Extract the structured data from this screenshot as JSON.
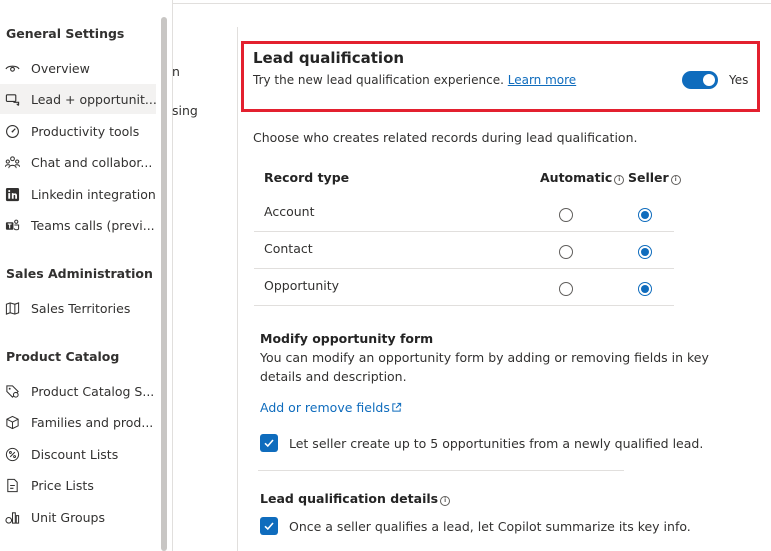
{
  "sidebar": {
    "sections": [
      {
        "title": "General Settings"
      },
      {
        "title": "Sales Administration"
      },
      {
        "title": "Product Catalog"
      }
    ],
    "items": [
      {
        "label": "Overview",
        "icon": "eye-icon"
      },
      {
        "label": "Lead + opportunit...",
        "icon": "lead-opportunity-icon",
        "selected": true
      },
      {
        "label": "Productivity tools",
        "icon": "gauge-icon"
      },
      {
        "label": "Chat and collabor...",
        "icon": "people-network-icon"
      },
      {
        "label": "Linkedin integration",
        "icon": "linkedin-icon"
      },
      {
        "label": "Teams calls (previ...",
        "icon": "teams-icon"
      },
      {
        "label": "Sales Territories",
        "icon": "map-icon"
      },
      {
        "label": "Product Catalog S...",
        "icon": "catalog-settings-icon"
      },
      {
        "label": "Families and prod...",
        "icon": "box-icon"
      },
      {
        "label": "Discount Lists",
        "icon": "percent-icon"
      },
      {
        "label": "Price Lists",
        "icon": "price-list-icon"
      },
      {
        "label": "Unit Groups",
        "icon": "unit-groups-icon"
      }
    ]
  },
  "middle": {
    "fragments": [
      "n",
      "sing"
    ]
  },
  "lead_qualification": {
    "title": "Lead qualification",
    "description": "Try the new lead qualification experience.",
    "learn_more": "Learn more",
    "toggle_label": "Yes",
    "toggle_on": true
  },
  "intro": "Choose who creates related records during lead qualification.",
  "record_table": {
    "headers": {
      "record_type": "Record type",
      "automatic": "Automatic",
      "seller": "Seller"
    },
    "rows": [
      {
        "label": "Account",
        "selected": "Seller"
      },
      {
        "label": "Contact",
        "selected": "Seller"
      },
      {
        "label": "Opportunity",
        "selected": "Seller"
      }
    ]
  },
  "modify_form": {
    "title": "Modify opportunity form",
    "description": "You can modify an opportunity form by adding or removing fields in key details and description.",
    "link": "Add or remove fields",
    "checkbox_label": "Let seller create up to 5 opportunities from a newly qualified lead.",
    "checkbox_checked": true
  },
  "details": {
    "title": "Lead qualification details",
    "checkbox_label": "Once a seller qualifies a lead, let Copilot summarize its key info.",
    "checkbox_checked": true
  },
  "colors": {
    "accent": "#0f6cbd",
    "highlight": "#e3202f"
  }
}
